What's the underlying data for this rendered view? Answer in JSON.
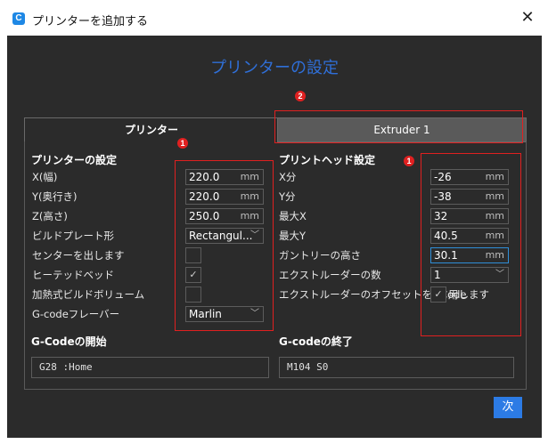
{
  "window": {
    "title": "プリンターを追加する",
    "icon_letter": "C",
    "close_glyph": "✕"
  },
  "heading": "プリンターの設定",
  "tabs": [
    {
      "label": "プリンター"
    },
    {
      "label": "Extruder 1"
    }
  ],
  "printer_section": {
    "title": "プリンターの設定",
    "rows": [
      {
        "label": "X(幅)",
        "value": "220.0",
        "unit": "mm"
      },
      {
        "label": "Y(奥行き)",
        "value": "220.0",
        "unit": "mm"
      },
      {
        "label": "Z(高さ)",
        "value": "250.0",
        "unit": "mm"
      }
    ],
    "build_plate_label": "ビルドプレート形",
    "build_plate_value": "Rectangul...",
    "center_label": "センターを出します",
    "center_checked": false,
    "heated_bed_label": "ヒーテッドベッド",
    "heated_bed_checked": true,
    "heated_volume_label": "加熱式ビルドボリューム",
    "heated_volume_checked": false,
    "flavor_label": "G-codeフレーバー",
    "flavor_value": "Marlin"
  },
  "printhead_section": {
    "title": "プリントヘッド設定",
    "rows": [
      {
        "label": "X分",
        "value": "-26",
        "unit": "mm"
      },
      {
        "label": "Y分",
        "value": "-38",
        "unit": "mm"
      },
      {
        "label": "最大X",
        "value": "32",
        "unit": "mm"
      },
      {
        "label": "最大Y",
        "value": "40.5",
        "unit": "mm"
      },
      {
        "label": "ガントリーの高さ",
        "value": "30.1",
        "unit": "mm"
      }
    ],
    "extruder_count_label": "エクストルーダーの数",
    "extruder_count_value": "1",
    "offset_label": "エクストルーダーのオフセットをGCode",
    "offset_suffix": "用します",
    "offset_checked": true
  },
  "gcode": {
    "start_title": "G-Codeの開始",
    "start_value": "G28 :Home",
    "end_title": "G-codeの終了",
    "end_value": "M104 S0"
  },
  "next_label": "次",
  "markers": [
    "1",
    "2",
    "1"
  ],
  "colors": {
    "accent": "#2c7be5",
    "dialog_bg": "#2b2b2b",
    "annotation": "#e02020"
  }
}
